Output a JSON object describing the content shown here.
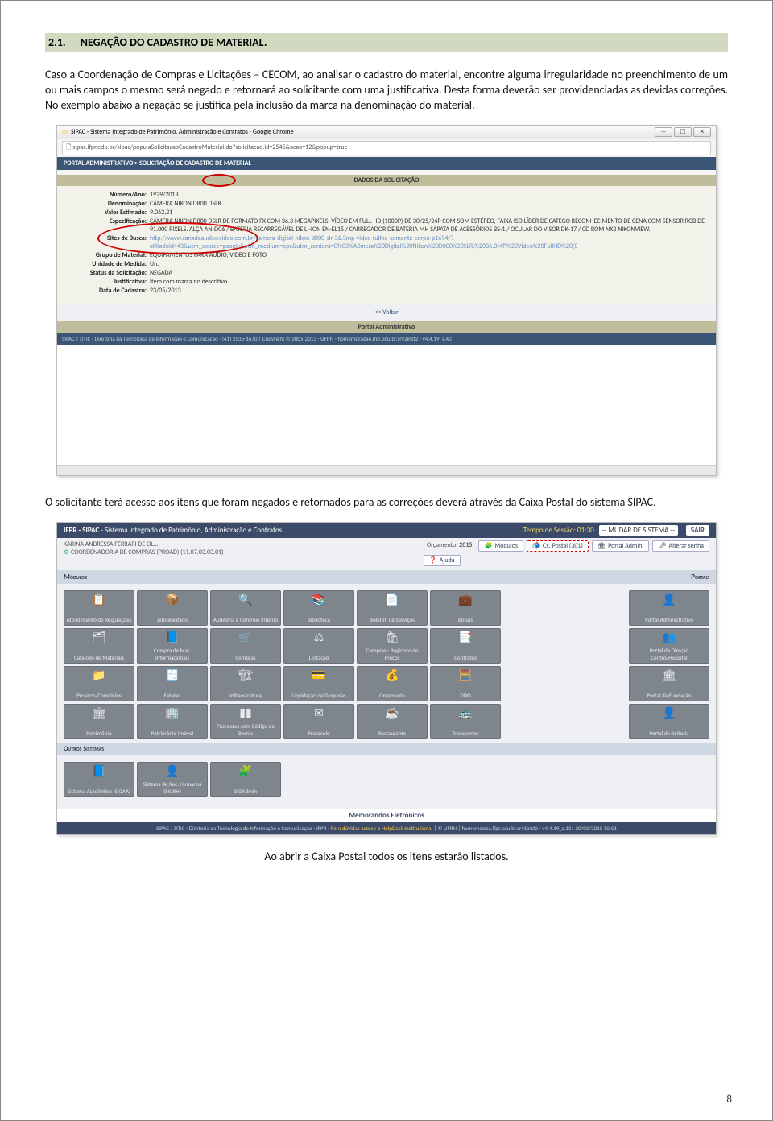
{
  "heading": {
    "number": "2.1.",
    "title": "NEGAÇÃO DO CADASTRO DE MATERIAL."
  },
  "para1": "Caso a Coordenação de Compras e Licitações – CECOM, ao analisar o cadastro do material, encontre alguma irregularidade no preenchimento de um ou mais campos o mesmo será negado e retornará ao solicitante com uma justificativa. Desta forma deverão ser providenciadas as devidas correções. No exemplo abaixo a negação se justifica pela inclusão da marca na denominação do material.",
  "shot1": {
    "window_title": "SIPAC - Sistema Integrado de Patrimônio, Administração e Contratos - Google Chrome",
    "url": "sipac.ifpr.edu.br/sipac/populaSolicitacaoCadastroMaterial.do?solicitacao.id=2545&acao=12&popup=true",
    "breadcrumb": "PORTAL ADMINISTRATIVO > SOLICITAÇÃO DE CADASTRO DE MATERIAL",
    "section_title": "DADOS DA SOLICITAÇÃO",
    "fields": {
      "numero_ano_label": "Número/Ano:",
      "numero_ano": "1929/2013",
      "denominacao_label": "Denominação:",
      "denominacao": "CÂMERA NIKON D800 DSLR",
      "valor_label": "Valor Estimado:",
      "valor": "9.062,21",
      "espec_label": "Especificação:",
      "espec": "CÂMERA NIKON D800 DSLR DE FORMATO FX COM 36.3 MEGAPIXELS, VÍDEO EM FULL HD (1080P) DE 30/25/24P COM SOM ESTÉREO, FAIXA ISO LÍDER DE CATEGO RECONHECIMENTO DE CENA COM SENSOR RGB DE 91.000 PIXELS. ALÇA AN-DC6 / BATERIA RECARREGÁVEL DE LI-ION EN-EL15 / CARREGADOR DE BATERIA MH SAPATA DE ACESSÓRIOS BS-1 / OCULAR DO VISOR DK-17 / CD ROM NX2 NIKONVIEW.",
      "sites_label": "Sites de Busca:",
      "sites": "http://www.canadaaudioevideo.com.br/camera-digital-nikon-d800-slr-36.3mp-video-fullhd-somente-corpo-p1694/?afiliadoid=43&utm_source=google&utm_medium=cpc&utm_content=C%C3%A2mera%20Digital%20Nikon%20D800%20SLR,%2036.3MP,%20Video%20FullHD%20(S",
      "grupo_label": "Grupo de Material:",
      "grupo": "EQUIPAMENTOS PARA AUDIO, VIDEO E FOTO",
      "unidade_label": "Unidade de Medida:",
      "unidade": "Un.",
      "status_label": "Status da Solicitação:",
      "status": "NEGADA",
      "justificativa_label": "Justificativa:",
      "justificativa": "Item com marca no descritivo.",
      "data_label": "Data de Cadastro:",
      "data": "23/05/2013"
    },
    "voltar": "<< Voltar",
    "portal": "Portal Administrativo",
    "footer": "SIPAC | DTIC - Diretoria da Tecnologia de Informação e Comunicação - (41) 3535-1670 | Copyright © 2005-2013 - UFRN - homemdragao.ifpr.edu.br.srv2inst2 - v4.4.19_s.40"
  },
  "para2": "O solicitante terá acesso aos itens que foram negados e retornados para as correções deverá através da  Caixa Postal do sistema SIPAC.",
  "shot2": {
    "brand": "IFPR - SIPAC",
    "brand_sub": "- Sistema Integrado de Patrimônio, Administração e Contratos",
    "tempo": "Tempo de Sessão: 01:30",
    "mudar": "-- MUDAR DE SISTEMA --",
    "sair": "SAIR",
    "user": "KARINA ANDRESSA FERRARI DE OL...",
    "unidade": "COORDENADORIA DE COMPRAS (PROAD) (11.07.03.03.01)",
    "orcamento_label": "Orçamento:",
    "orcamento": "2015",
    "btn_modulos": "Módulos",
    "btn_caixa": "Cx. Postal (301)",
    "btn_portal": "Portal Admin.",
    "btn_ajuda": "Ajuda",
    "btn_alterar": "Alterar senha",
    "section_modulos": "Módulos",
    "section_portais": "Portais",
    "tiles_main": [
      [
        "Atendimento de Requisições",
        "📋"
      ],
      [
        "Almoxarifado",
        "📦"
      ],
      [
        "Auditoria e Controle Interno",
        "🔍"
      ],
      [
        "Biblioteca",
        "📚"
      ],
      [
        "Boletim de Serviços",
        "📄"
      ],
      [
        "Bolsas",
        "💼"
      ],
      [
        "Catálogo de Materiais",
        "🗂"
      ],
      [
        "Compra de Mat. Informacionais",
        "📘"
      ],
      [
        "Compras",
        "🛒"
      ],
      [
        "Licitação",
        "⚖"
      ],
      [
        "Compras - Registros de Preços",
        "🛍"
      ],
      [
        "Contratos",
        "📑"
      ],
      [
        "Projetos/Convênios",
        "📁"
      ],
      [
        "Faturas",
        "🧾"
      ],
      [
        "Infraestrutura",
        "🏗"
      ],
      [
        "Liquidação de Despesas",
        "💳"
      ],
      [
        "Orçamento",
        "💰"
      ],
      [
        "DDO",
        "🧮"
      ],
      [
        "Patrimônio",
        "🏛"
      ],
      [
        "Patrimônio Imóvel",
        "🏢"
      ],
      [
        "Processos com Código de Barras",
        "▮▮"
      ],
      [
        "Protocolo",
        "✉"
      ],
      [
        "Restaurante",
        "☕"
      ],
      [
        "Transportes",
        "🚌"
      ]
    ],
    "tiles_side": [
      [
        "Portal Administrativo",
        "👤"
      ],
      [
        "Portal da Direção Centro/Hospital",
        "👥"
      ],
      [
        "Portal da Fundação",
        "🏛"
      ],
      [
        "Portal da Reitoria",
        "👤"
      ]
    ],
    "outros_head": "Outros Sistemas",
    "tiles_outros": [
      [
        "Sistema Acadêmico (SIGAA)",
        "📘"
      ],
      [
        "Sistema de Rec. Humanos (SIGRH)",
        "👤"
      ],
      [
        "SIGAdmin",
        "🧩"
      ]
    ],
    "memo": "Memorandos Eletrônicos",
    "footer_left": "SIPAC | DTIC - Diretoria da Tecnologia de Informação e Comunicação - IFPR -",
    "footer_link": "Para dúvidas acesse o HelpDesk Institucional",
    "footer_right": " | © UFRN | homemcoisa.ifpr.edu.br.srv1inst2 - v4.4.19_s.131 20/03/2015 10:51"
  },
  "caption": "Ao abrir a Caixa Postal todos os itens estarão listados.",
  "page_number": "8"
}
